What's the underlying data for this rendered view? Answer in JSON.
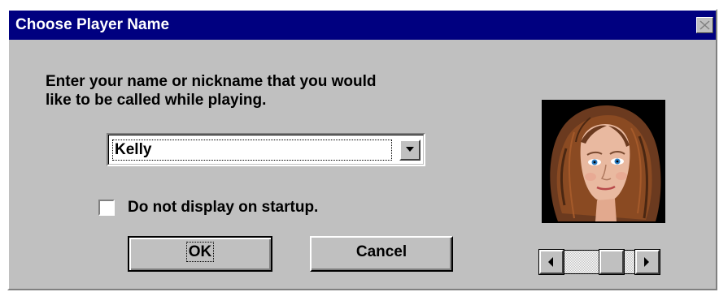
{
  "window": {
    "title": "Choose Player Name"
  },
  "prompt": {
    "line1": "Enter your name or nickname that you would",
    "line2": "like to be called while playing."
  },
  "name_combo": {
    "value": "Kelly"
  },
  "startup_checkbox": {
    "label": "Do not display on startup.",
    "checked": false
  },
  "buttons": {
    "ok_label": "OK",
    "cancel_label": "Cancel"
  },
  "avatar_scroller": {
    "position_fraction": 0.75
  },
  "icons": {
    "close": "close-icon",
    "dropdown": "chevron-down-icon",
    "scroll_left": "arrow-left-icon",
    "scroll_right": "arrow-right-icon"
  },
  "colors": {
    "titlebar": "#000080",
    "face": "#c0c0c0"
  }
}
